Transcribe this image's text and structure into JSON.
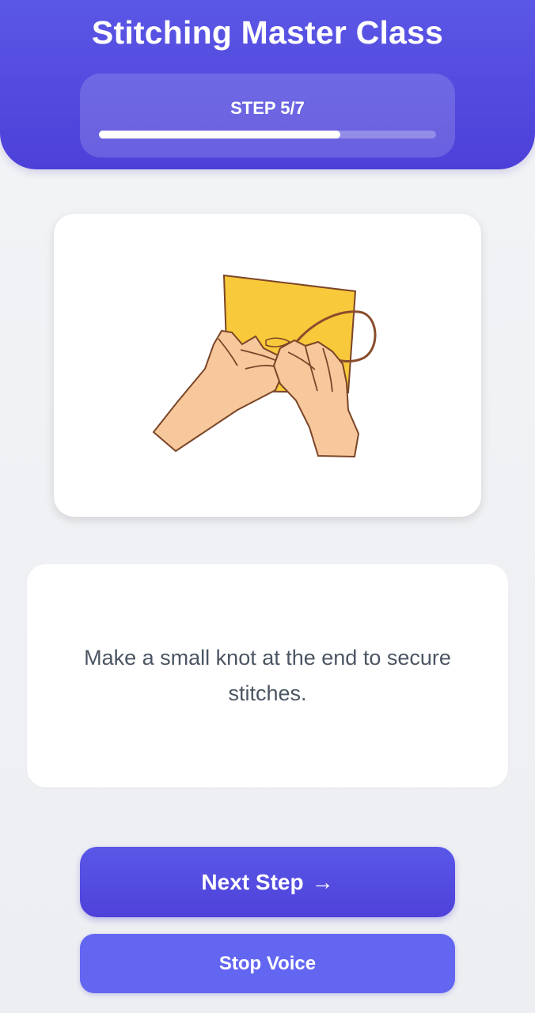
{
  "header": {
    "title": "Stitching Master Class",
    "step_label": "STEP 5/7",
    "progress_fraction": 0.715
  },
  "illustration": {
    "icon": "hands-stitching-fabric-illustration",
    "fabric_color": "#f8c93a",
    "skin_color": "#f7c89b",
    "outline_color": "#7a4528"
  },
  "instruction": {
    "text": "Make a small knot at the end to secure stitches."
  },
  "buttons": {
    "next_label": "Next Step",
    "next_arrow": "→",
    "stop_label": "Stop Voice"
  },
  "colors": {
    "accent": "#5b57e6",
    "accent_dark": "#4c40d8",
    "button_secondary": "#6366f1"
  }
}
